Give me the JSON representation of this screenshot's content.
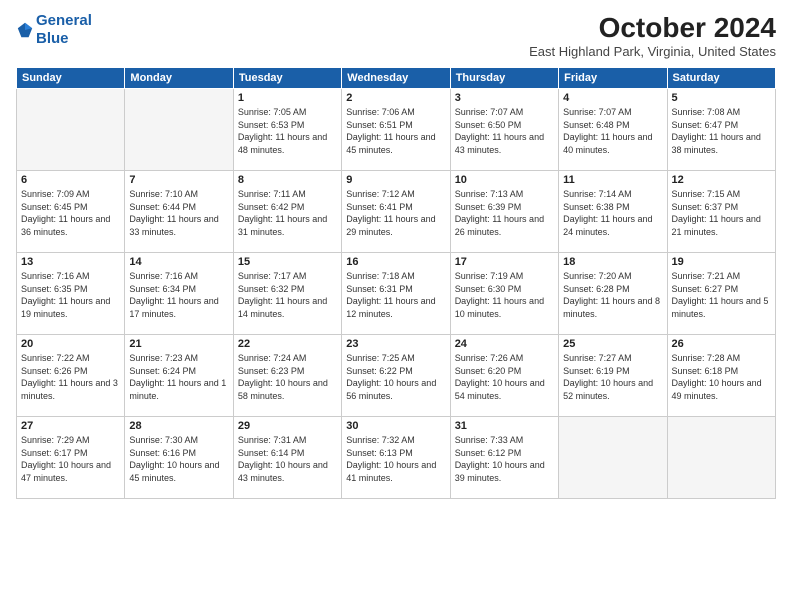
{
  "header": {
    "logo_line1": "General",
    "logo_line2": "Blue",
    "month": "October 2024",
    "location": "East Highland Park, Virginia, United States"
  },
  "weekdays": [
    "Sunday",
    "Monday",
    "Tuesday",
    "Wednesday",
    "Thursday",
    "Friday",
    "Saturday"
  ],
  "weeks": [
    [
      {
        "day": "",
        "detail": ""
      },
      {
        "day": "",
        "detail": ""
      },
      {
        "day": "1",
        "detail": "Sunrise: 7:05 AM\nSunset: 6:53 PM\nDaylight: 11 hours and 48 minutes."
      },
      {
        "day": "2",
        "detail": "Sunrise: 7:06 AM\nSunset: 6:51 PM\nDaylight: 11 hours and 45 minutes."
      },
      {
        "day": "3",
        "detail": "Sunrise: 7:07 AM\nSunset: 6:50 PM\nDaylight: 11 hours and 43 minutes."
      },
      {
        "day": "4",
        "detail": "Sunrise: 7:07 AM\nSunset: 6:48 PM\nDaylight: 11 hours and 40 minutes."
      },
      {
        "day": "5",
        "detail": "Sunrise: 7:08 AM\nSunset: 6:47 PM\nDaylight: 11 hours and 38 minutes."
      }
    ],
    [
      {
        "day": "6",
        "detail": "Sunrise: 7:09 AM\nSunset: 6:45 PM\nDaylight: 11 hours and 36 minutes."
      },
      {
        "day": "7",
        "detail": "Sunrise: 7:10 AM\nSunset: 6:44 PM\nDaylight: 11 hours and 33 minutes."
      },
      {
        "day": "8",
        "detail": "Sunrise: 7:11 AM\nSunset: 6:42 PM\nDaylight: 11 hours and 31 minutes."
      },
      {
        "day": "9",
        "detail": "Sunrise: 7:12 AM\nSunset: 6:41 PM\nDaylight: 11 hours and 29 minutes."
      },
      {
        "day": "10",
        "detail": "Sunrise: 7:13 AM\nSunset: 6:39 PM\nDaylight: 11 hours and 26 minutes."
      },
      {
        "day": "11",
        "detail": "Sunrise: 7:14 AM\nSunset: 6:38 PM\nDaylight: 11 hours and 24 minutes."
      },
      {
        "day": "12",
        "detail": "Sunrise: 7:15 AM\nSunset: 6:37 PM\nDaylight: 11 hours and 21 minutes."
      }
    ],
    [
      {
        "day": "13",
        "detail": "Sunrise: 7:16 AM\nSunset: 6:35 PM\nDaylight: 11 hours and 19 minutes."
      },
      {
        "day": "14",
        "detail": "Sunrise: 7:16 AM\nSunset: 6:34 PM\nDaylight: 11 hours and 17 minutes."
      },
      {
        "day": "15",
        "detail": "Sunrise: 7:17 AM\nSunset: 6:32 PM\nDaylight: 11 hours and 14 minutes."
      },
      {
        "day": "16",
        "detail": "Sunrise: 7:18 AM\nSunset: 6:31 PM\nDaylight: 11 hours and 12 minutes."
      },
      {
        "day": "17",
        "detail": "Sunrise: 7:19 AM\nSunset: 6:30 PM\nDaylight: 11 hours and 10 minutes."
      },
      {
        "day": "18",
        "detail": "Sunrise: 7:20 AM\nSunset: 6:28 PM\nDaylight: 11 hours and 8 minutes."
      },
      {
        "day": "19",
        "detail": "Sunrise: 7:21 AM\nSunset: 6:27 PM\nDaylight: 11 hours and 5 minutes."
      }
    ],
    [
      {
        "day": "20",
        "detail": "Sunrise: 7:22 AM\nSunset: 6:26 PM\nDaylight: 11 hours and 3 minutes."
      },
      {
        "day": "21",
        "detail": "Sunrise: 7:23 AM\nSunset: 6:24 PM\nDaylight: 11 hours and 1 minute."
      },
      {
        "day": "22",
        "detail": "Sunrise: 7:24 AM\nSunset: 6:23 PM\nDaylight: 10 hours and 58 minutes."
      },
      {
        "day": "23",
        "detail": "Sunrise: 7:25 AM\nSunset: 6:22 PM\nDaylight: 10 hours and 56 minutes."
      },
      {
        "day": "24",
        "detail": "Sunrise: 7:26 AM\nSunset: 6:20 PM\nDaylight: 10 hours and 54 minutes."
      },
      {
        "day": "25",
        "detail": "Sunrise: 7:27 AM\nSunset: 6:19 PM\nDaylight: 10 hours and 52 minutes."
      },
      {
        "day": "26",
        "detail": "Sunrise: 7:28 AM\nSunset: 6:18 PM\nDaylight: 10 hours and 49 minutes."
      }
    ],
    [
      {
        "day": "27",
        "detail": "Sunrise: 7:29 AM\nSunset: 6:17 PM\nDaylight: 10 hours and 47 minutes."
      },
      {
        "day": "28",
        "detail": "Sunrise: 7:30 AM\nSunset: 6:16 PM\nDaylight: 10 hours and 45 minutes."
      },
      {
        "day": "29",
        "detail": "Sunrise: 7:31 AM\nSunset: 6:14 PM\nDaylight: 10 hours and 43 minutes."
      },
      {
        "day": "30",
        "detail": "Sunrise: 7:32 AM\nSunset: 6:13 PM\nDaylight: 10 hours and 41 minutes."
      },
      {
        "day": "31",
        "detail": "Sunrise: 7:33 AM\nSunset: 6:12 PM\nDaylight: 10 hours and 39 minutes."
      },
      {
        "day": "",
        "detail": ""
      },
      {
        "day": "",
        "detail": ""
      }
    ]
  ]
}
